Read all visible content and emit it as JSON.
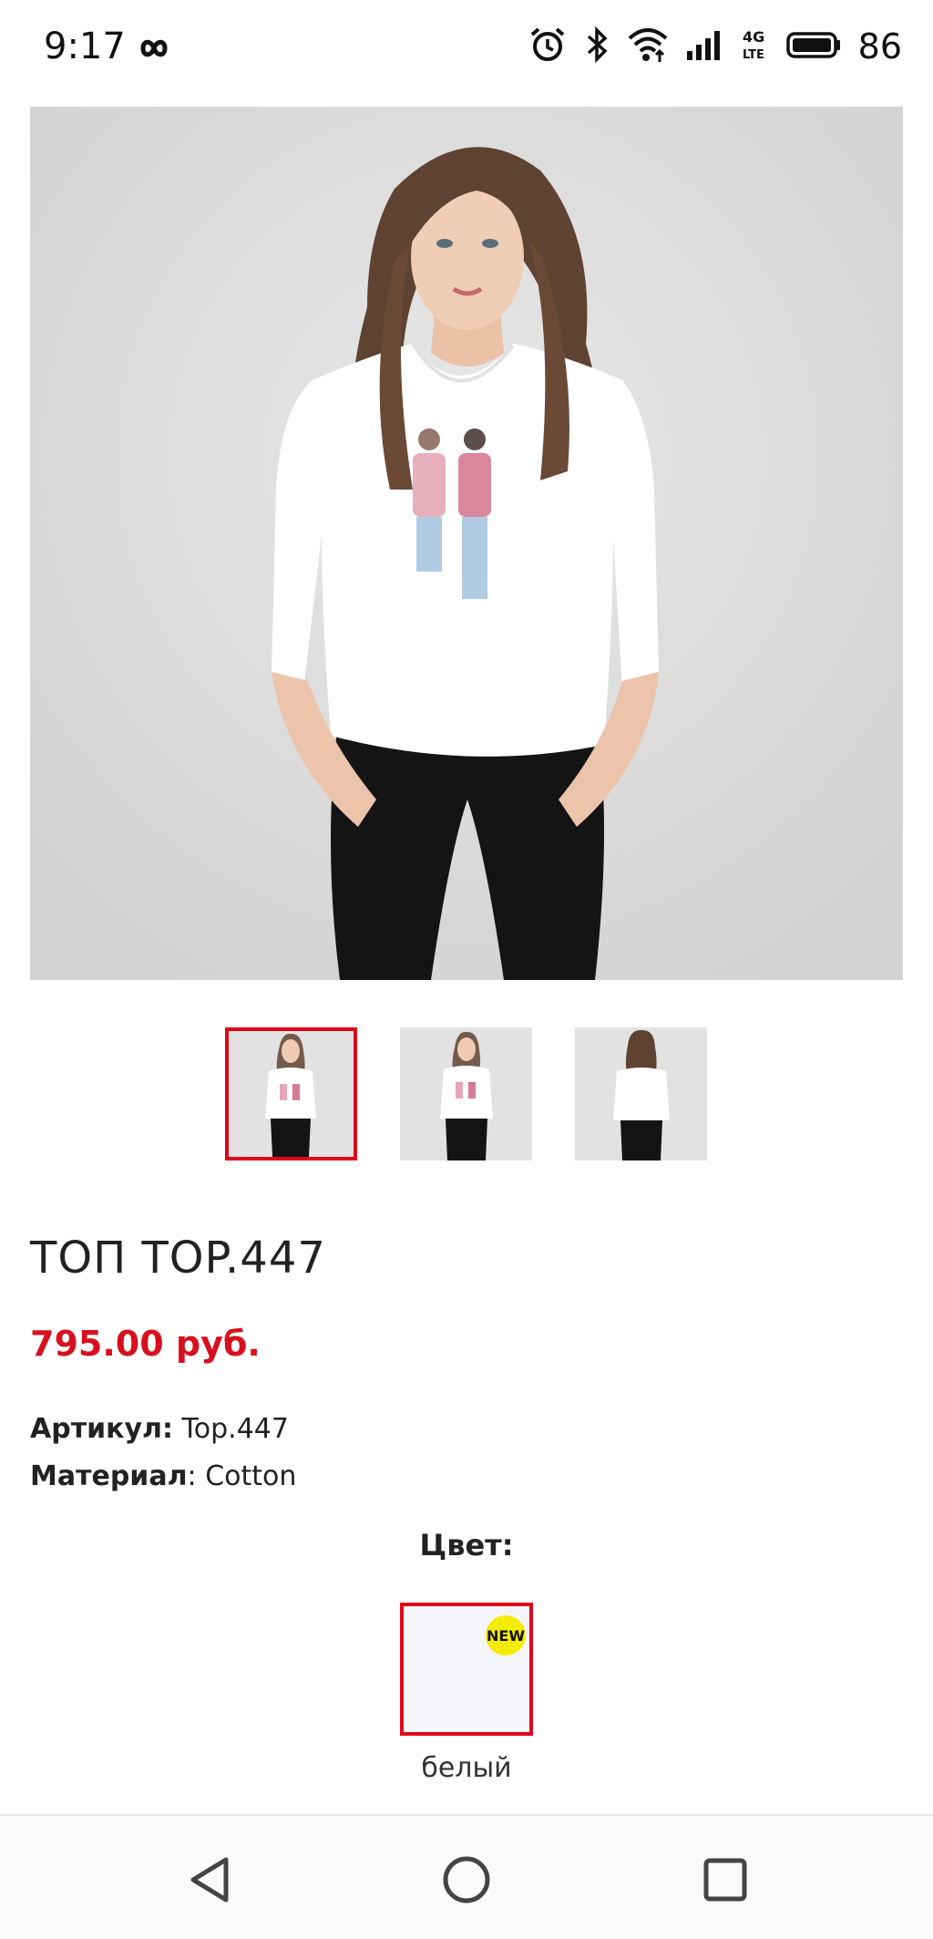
{
  "status_bar": {
    "time": "9:17",
    "network_label": "4G LTE",
    "battery": "86"
  },
  "product": {
    "title": "ТОП TOP.447",
    "price": "795.00 руб.",
    "article_label": "Артикул:",
    "article_value": "Top.447",
    "material_label": "Материал",
    "material_value": ": Cotton",
    "color_heading": "Цвет:",
    "color_swatch": {
      "name": "белый",
      "badge": "NEW",
      "color": "#f6f6fa"
    }
  },
  "gallery": {
    "selected_index": 0,
    "thumbnail_count": 3
  },
  "colors": {
    "accent": "#e0061a",
    "price": "#d8101d",
    "badge": "#f5ec06"
  },
  "nav": {
    "back_icon": "back-triangle-icon",
    "home_icon": "home-circle-icon",
    "recents_icon": "recents-square-icon"
  }
}
